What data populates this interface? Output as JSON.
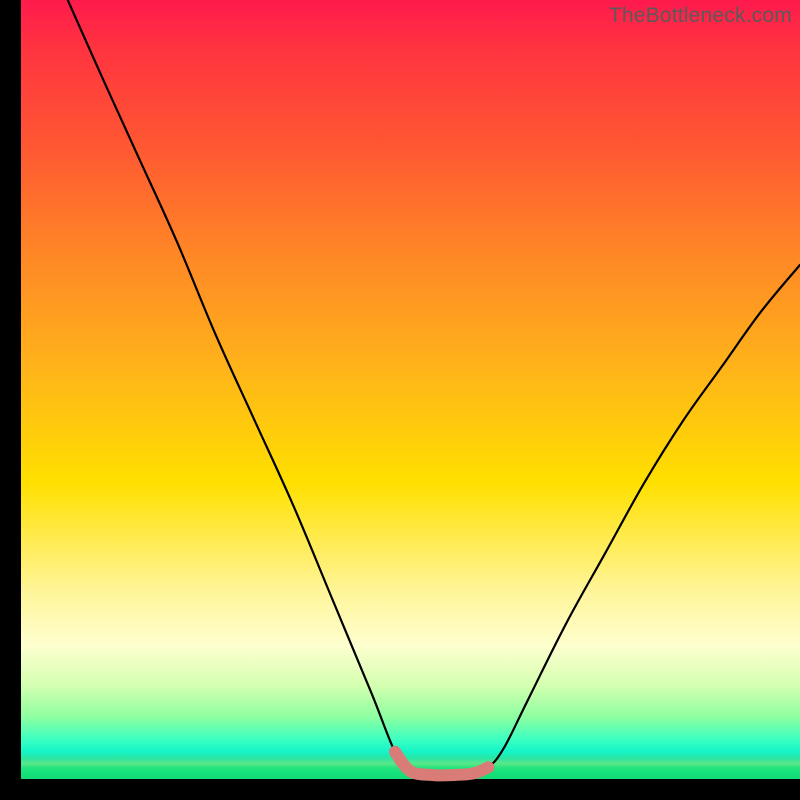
{
  "watermark": "TheBottleneck.com",
  "chart_data": {
    "type": "line",
    "title": "",
    "xlabel": "",
    "ylabel": "",
    "xlim": [
      0,
      100
    ],
    "ylim": [
      0,
      100
    ],
    "series": [
      {
        "name": "bottleneck-curve",
        "x": [
          6,
          10,
          15,
          20,
          25,
          30,
          35,
          40,
          45,
          48,
          50,
          53,
          55,
          58,
          60,
          62,
          65,
          70,
          75,
          80,
          85,
          90,
          95,
          100
        ],
        "y": [
          100,
          91,
          80,
          69,
          57,
          46,
          35,
          23,
          11,
          3.5,
          1,
          0.5,
          0.5,
          0.7,
          1.5,
          4,
          10,
          20,
          29,
          38,
          46,
          53,
          60,
          66
        ]
      }
    ],
    "highlight": {
      "name": "optimal-range",
      "x": [
        48,
        50,
        53,
        55,
        58,
        60
      ],
      "y": [
        3.5,
        1,
        0.5,
        0.5,
        0.7,
        1.5
      ]
    },
    "colors": {
      "curve": "#000000",
      "highlight": "#d97b77",
      "gradient_top": "#ff1a4d",
      "gradient_bottom": "#13d973"
    }
  }
}
